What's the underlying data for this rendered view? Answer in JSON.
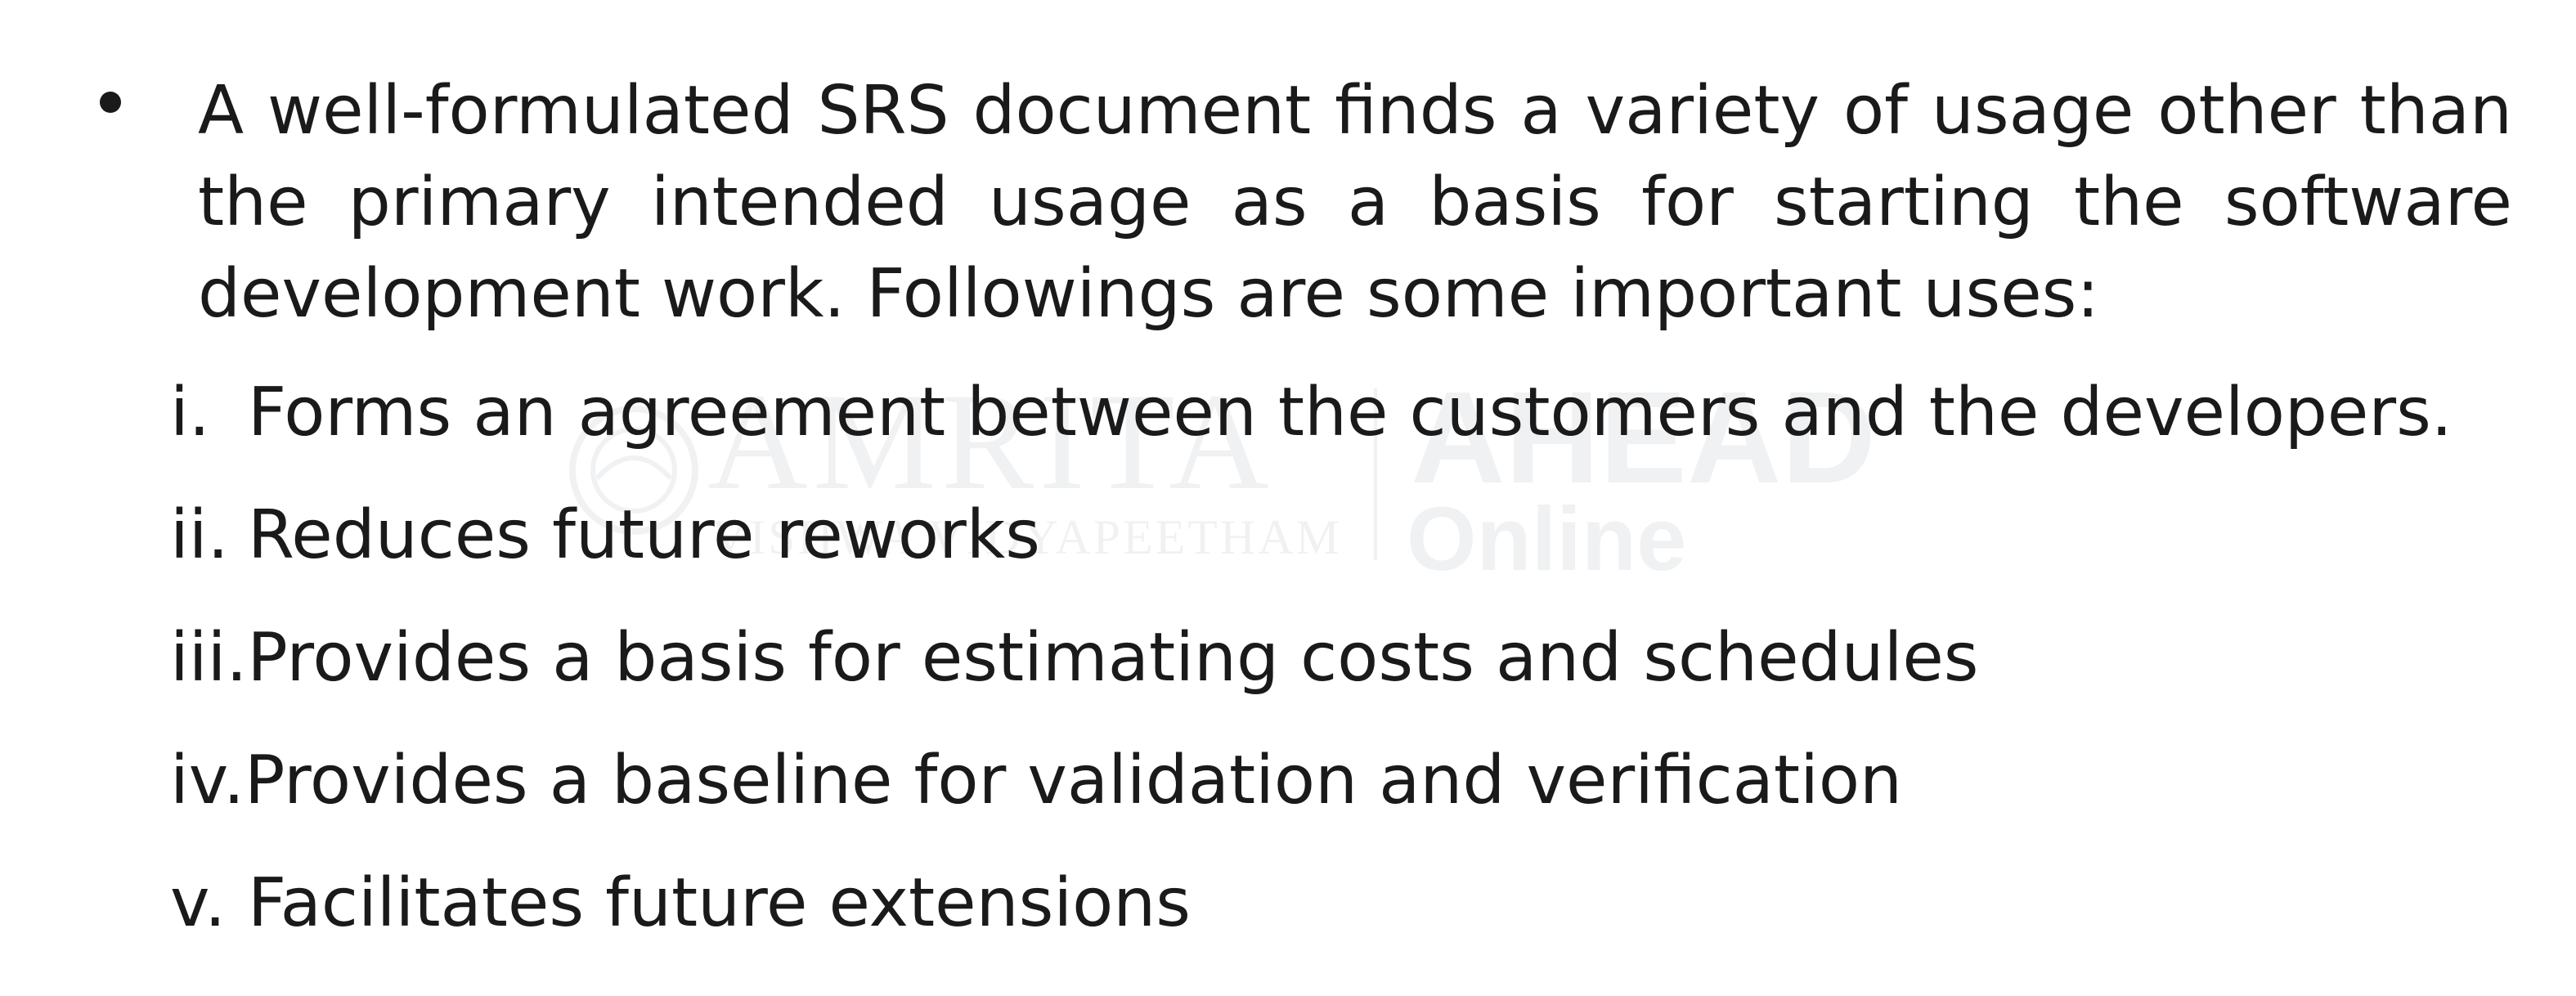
{
  "slide": {
    "intro": "A well-formulated SRS document finds a variety of usage other than the primary intended usage as a basis for starting the software development work. Followings are some important uses:",
    "uses": [
      {
        "numeral": "i.",
        "text": "Forms an agreement between the customers and the developers."
      },
      {
        "numeral": "ii.",
        "text": "Reduces future reworks"
      },
      {
        "numeral": "iii.",
        "text": "Provides a basis for estimating costs and schedules"
      },
      {
        "numeral": "iv.",
        "text": "Provides a baseline for validation and verification"
      },
      {
        "numeral": "v.",
        "text": "Facilitates future extensions"
      }
    ]
  },
  "watermark": {
    "line1": "AMRITA",
    "line2": "VISHWA VIDYAPEETHAM",
    "line3": "AHEAD",
    "line4": "Online"
  },
  "colors": {
    "text": "#1a1a1a",
    "background": "#ffffff",
    "watermark": "#3a4f6a"
  }
}
